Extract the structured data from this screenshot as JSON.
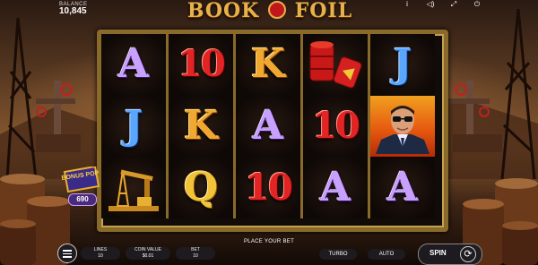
{
  "balance": {
    "label": "BALANCE",
    "value": "10,845"
  },
  "logo": {
    "part1": "BOOK",
    "part2": "FOIL"
  },
  "reels": [
    [
      {
        "sym": "A"
      },
      {
        "sym": "J"
      },
      {
        "sym": "oil-rig-icon"
      }
    ],
    [
      {
        "sym": "10"
      },
      {
        "sym": "K"
      },
      {
        "sym": "Q"
      }
    ],
    [
      {
        "sym": "K"
      },
      {
        "sym": "A"
      },
      {
        "sym": "10"
      }
    ],
    [
      {
        "sym": "oil-barrels-icon"
      },
      {
        "sym": "10"
      },
      {
        "sym": "A"
      }
    ],
    [
      {
        "sym": "J"
      },
      {
        "sym": "man-portrait"
      },
      {
        "sym": "A"
      }
    ]
  ],
  "bonus_pop": {
    "label": "BONUS POP",
    "value": "690"
  },
  "status": {
    "message": "PLACE YOUR BET"
  },
  "controls": {
    "lines": {
      "label": "LINES",
      "value": "10"
    },
    "coin_value": {
      "label": "COIN VALUE",
      "value": "$0.01"
    },
    "bet": {
      "label": "BET",
      "value": "10"
    },
    "turbo_label": "TURBO",
    "auto_label": "AUTO",
    "spin_label": "SPIN"
  },
  "colors": {
    "frame": "#8a6a2a",
    "ace": "#c8a0ff",
    "jack": "#5aa6ff",
    "ten": "#e22424",
    "king": "#f0a830",
    "queen": "#f2c238"
  }
}
